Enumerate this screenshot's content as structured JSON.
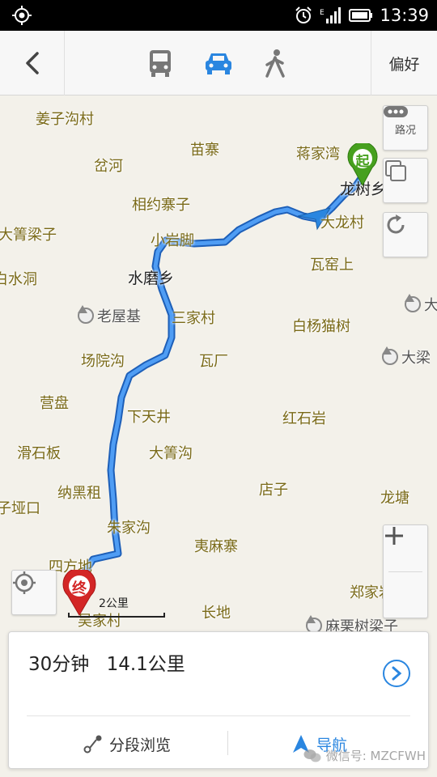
{
  "status_bar": {
    "time": "13:39"
  },
  "top_bar": {
    "preference_label": "偏好"
  },
  "map": {
    "labels": {
      "jiangzigoucun": "姜子沟村",
      "chahe": "岔河",
      "miaozhai": "苗寨",
      "jiangjiawan": "蒋家湾",
      "longshuxiang": "龙树乡",
      "xiangyuezhaizi": "相约寨子",
      "dajingliangzi": "大箐梁子",
      "xiaoyanjiao": "小岩脚",
      "dalongcun": "大龙村",
      "wayaoshang": "瓦窑上",
      "baishuidong": "白水洞",
      "shuimoxiang": "水磨乡",
      "laowuji": "老屋基",
      "sanjiacun": "三家村",
      "baiyangmaoshu": "白杨猫树",
      "da_right": "大",
      "changyuangou": "场院沟",
      "wachang": "瓦厂",
      "daliang": "大梁",
      "yingpan": "营盘",
      "xiatianjing": "下天井",
      "hongshiyan": "红石岩",
      "huashiban": "滑石板",
      "dajinggou": "大箐沟",
      "nahengzu": "纳黑租",
      "dianzi": "店子",
      "longtang": "龙塘",
      "ziyakou": "子垭口",
      "zhujiagou": "朱家沟",
      "yimazhai": "夷麻寨",
      "sifangdi": "四方地",
      "zhengjiayan": "郑家岩子",
      "wujiacun": "吴家村",
      "changdi": "长地",
      "malishuliangzi": "麻栗树梁子"
    },
    "traffic_label": "路况",
    "start_marker": "起",
    "end_marker": "终",
    "scale_label": "2公里",
    "route_color": "#3b8cf0"
  },
  "panel": {
    "duration": "30分钟",
    "distance": "14.1公里",
    "segment_label": "分段浏览",
    "navigate_label": "导航",
    "watermark": "微信号: MZCFWH"
  }
}
